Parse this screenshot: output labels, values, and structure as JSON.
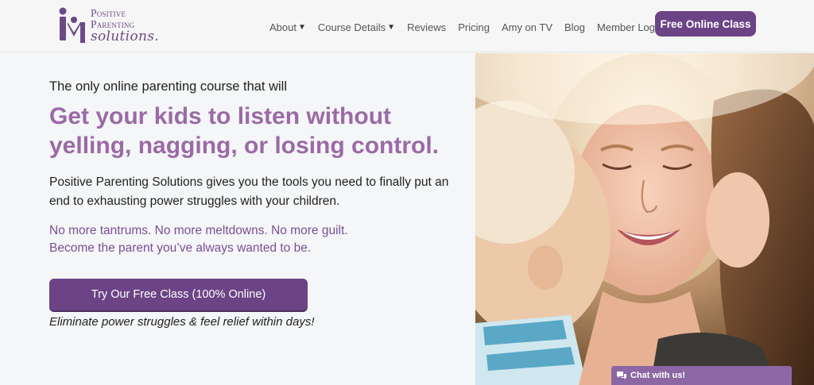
{
  "brand": {
    "logo_line1": "Positive",
    "logo_line2": "Parenting",
    "logo_line3": "solutions."
  },
  "nav": {
    "items": [
      {
        "label": "About",
        "has_dropdown": true
      },
      {
        "label": "Course Details",
        "has_dropdown": true
      },
      {
        "label": "Reviews",
        "has_dropdown": false
      },
      {
        "label": "Pricing",
        "has_dropdown": false
      },
      {
        "label": "Amy on TV",
        "has_dropdown": false
      },
      {
        "label": "Blog",
        "has_dropdown": false
      },
      {
        "label": "Member Login",
        "has_dropdown": false
      }
    ],
    "cta_label": "Free Online Class"
  },
  "hero": {
    "intro": "The only online parenting course that will",
    "headline": "Get your kids to listen without yelling, nagging, or losing control.",
    "body": "Positive Parenting Solutions gives you the tools you need to finally put an end to exhausting power struggles with your children.",
    "sub_line1": "No more tantrums. No more meltdowns. No more guilt.",
    "sub_line2": "Become the parent you’ve always wanted to be.",
    "cta_label": "Try Our Free Class (100% Online)",
    "tagline": "Eliminate power struggles & feel relief within days!"
  },
  "chat": {
    "label": "Chat with us!"
  },
  "colors": {
    "brand_purple": "#6c4486",
    "headline_purple": "#9b6aa6",
    "sub_purple": "#7a4f94",
    "chat_purple": "#8d67a4"
  }
}
